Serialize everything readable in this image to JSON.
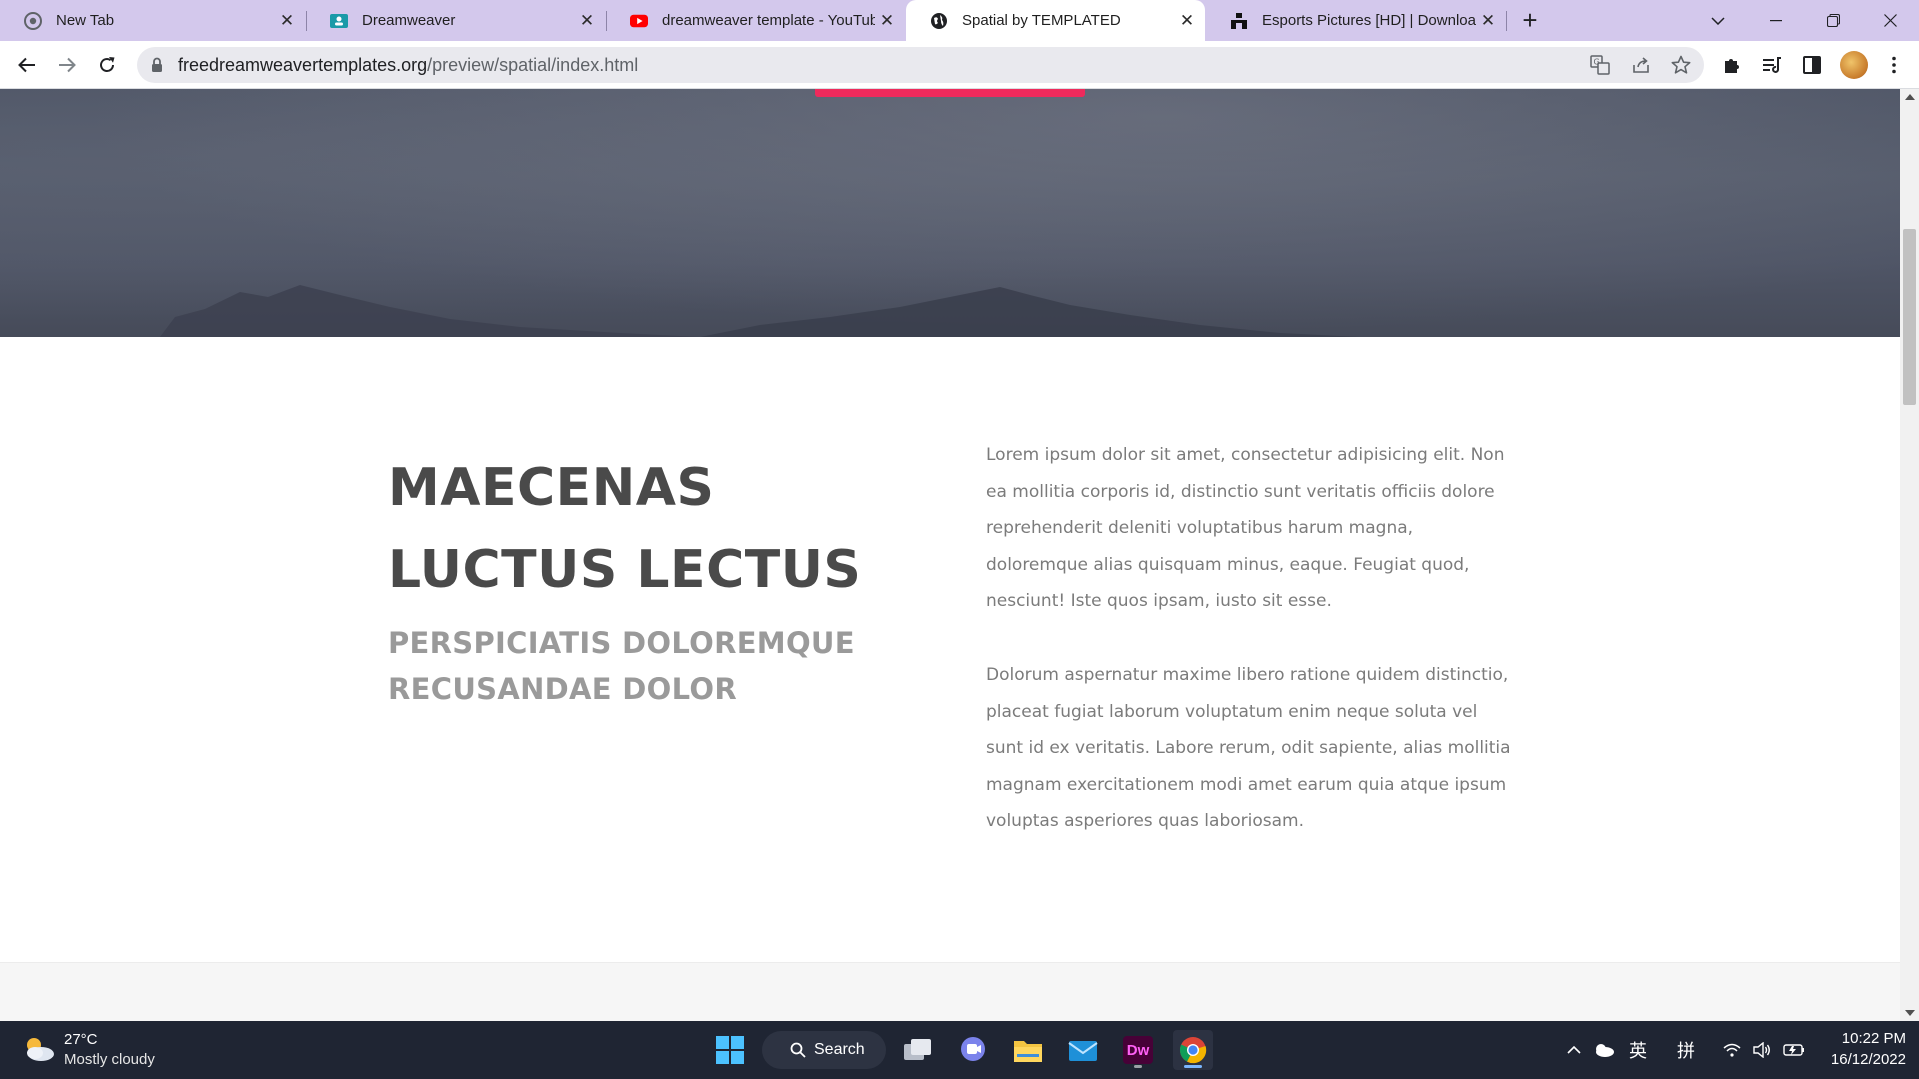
{
  "browser": {
    "tabs": [
      {
        "title": "New Tab",
        "icon": "chrome-icon",
        "active": false
      },
      {
        "title": "Dreamweaver",
        "icon": "classroom-icon",
        "active": false
      },
      {
        "title": "dreamweaver template - YouTube",
        "icon": "youtube-icon",
        "active": false
      },
      {
        "title": "Spatial by TEMPLATED",
        "icon": "globe-icon",
        "active": true
      },
      {
        "title": "Esports Pictures [HD] | Download",
        "icon": "unsplash-icon",
        "active": false
      }
    ],
    "new_tab_label": "+",
    "url_host": "freedreamweavertemplates.org",
    "url_path": "/preview/spatial/index.html"
  },
  "page": {
    "heading": "MAECENAS LUCTUS LECTUS",
    "subheading": "PERSPICIATIS DOLOREMQUE RECUSANDAE DOLOR",
    "paragraph1": "Lorem ipsum dolor sit amet, consectetur adipisicing elit. Non ea mollitia corporis id, distinctio sunt veritatis officiis dolore reprehenderit deleniti voluptatibus harum magna, doloremque alias quisquam minus, eaque. Feugiat quod, nesciunt! Iste quos ipsam, iusto sit esse.",
    "paragraph2": "Dolorum aspernatur maxime libero ratione quidem distinctio, placeat fugiat laborum voluptatum enim neque soluta vel sunt id ex veritatis. Labore rerum, odit sapiente, alias mollitia magnam exercitationem modi amet earum quia atque ipsum voluptas asperiores quas laboriosam."
  },
  "taskbar": {
    "weather_temp": "27°C",
    "weather_desc": "Mostly cloudy",
    "search_label": "Search",
    "dw_label": "Dw",
    "ime_lang": "英",
    "ime_mode": "拼",
    "time": "10:22 PM",
    "date": "16/12/2022"
  },
  "colors": {
    "tabstrip": "#d3c8ec",
    "accent_button": "#ef2a5c",
    "heading": "#4a4a4a",
    "subheading": "#9a9a9a",
    "body_text": "#7b7b7b",
    "taskbar": "#1f2533"
  }
}
